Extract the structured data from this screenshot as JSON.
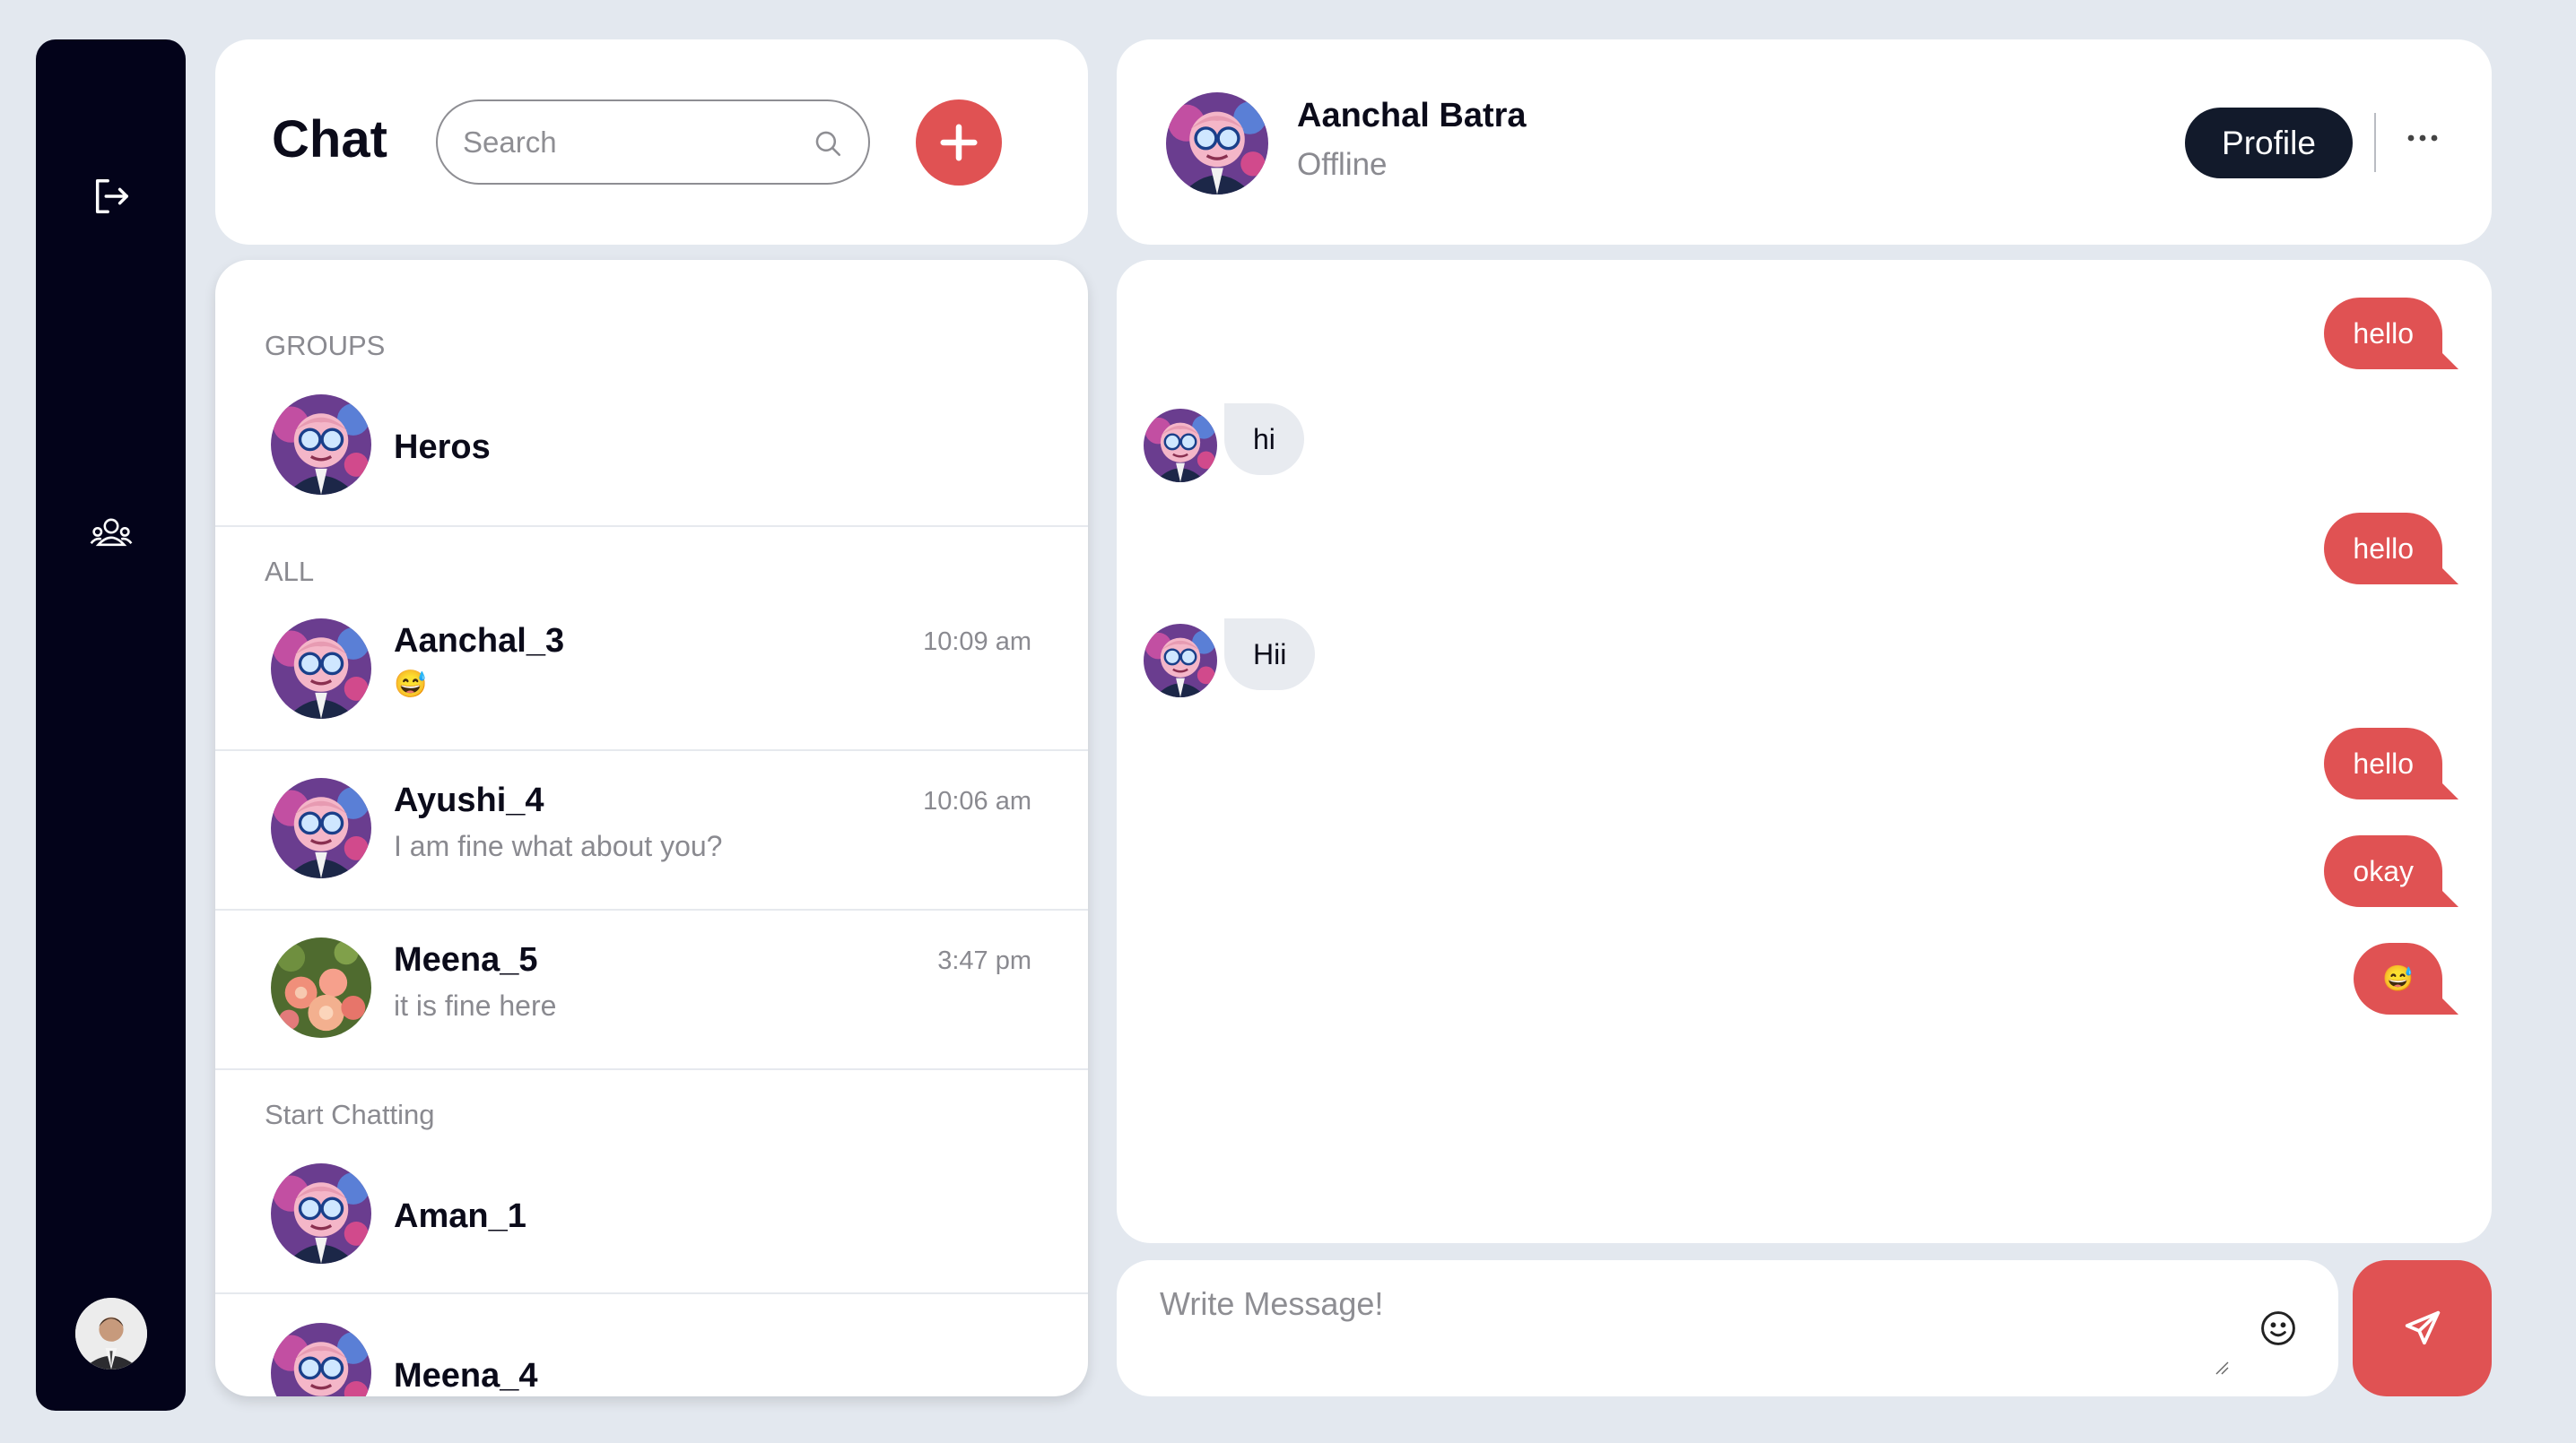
{
  "app": {
    "title": "Chat",
    "accent_color": "#e05253",
    "sidebar_color": "#03031a"
  },
  "sidebar": {
    "icons": [
      "logout-icon",
      "users-icon"
    ],
    "avatar": "user-photo-avatar"
  },
  "search": {
    "placeholder": "Search"
  },
  "list": {
    "groups_label": "GROUPS",
    "groups": [
      {
        "name": "Heros",
        "avatar": "cartoon-avatar"
      }
    ],
    "all_label": "ALL",
    "chats": [
      {
        "name": "Aanchal_3",
        "time": "10:09 am",
        "preview": "😅",
        "avatar": "cartoon-avatar"
      },
      {
        "name": "Ayushi_4",
        "time": "10:06 am",
        "preview": "I am fine what about you?",
        "avatar": "cartoon-avatar"
      },
      {
        "name": "Meena_5",
        "time": "3:47 pm",
        "preview": "it is fine here",
        "avatar": "flowers-avatar"
      }
    ],
    "start_label": "Start Chatting",
    "contacts": [
      {
        "name": "Aman_1",
        "avatar": "cartoon-avatar"
      },
      {
        "name": "Meena_4",
        "avatar": "cartoon-avatar"
      }
    ]
  },
  "conversation": {
    "name": "Aanchal Batra",
    "status": "Offline",
    "profile_label": "Profile",
    "messages": [
      {
        "dir": "out",
        "text": "hello"
      },
      {
        "dir": "in",
        "text": "hi"
      },
      {
        "dir": "out",
        "text": "hello"
      },
      {
        "dir": "in",
        "text": "Hii"
      },
      {
        "dir": "out",
        "text": "hello"
      },
      {
        "dir": "out",
        "text": "okay"
      },
      {
        "dir": "out",
        "text": "😅"
      }
    ]
  },
  "composer": {
    "placeholder": "Write Message!"
  }
}
